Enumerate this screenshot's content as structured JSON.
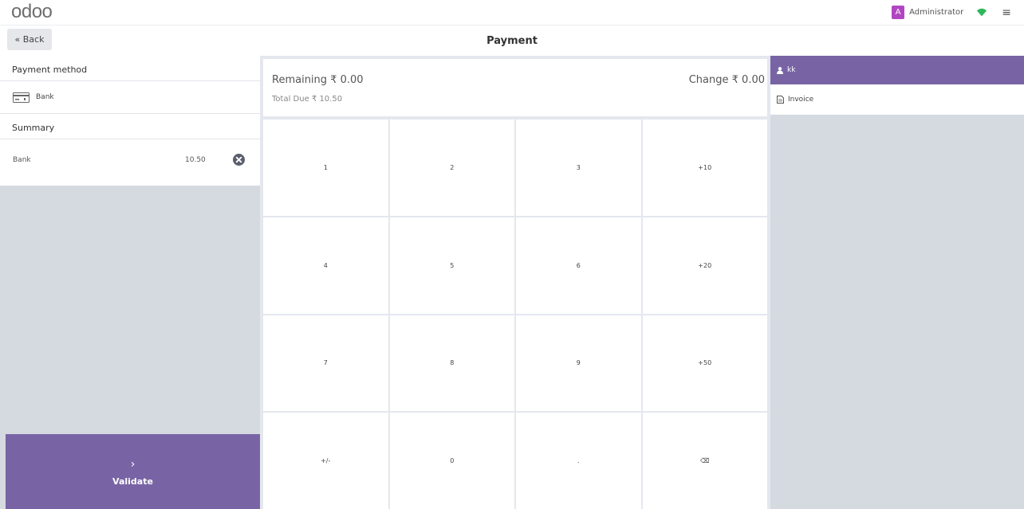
{
  "app": {
    "logo": "odoo"
  },
  "header": {
    "user_initial": "A",
    "user_name": "Administrator",
    "wifi_icon": "wifi-icon",
    "menu_icon": "hamburger-icon"
  },
  "subheader": {
    "back_label": "« Back",
    "title": "Payment"
  },
  "payment_methods": {
    "heading": "Payment method",
    "items": [
      {
        "label": "Bank",
        "icon": "bank-card-icon"
      }
    ]
  },
  "summary": {
    "heading": "Summary",
    "lines": [
      {
        "method": "Bank",
        "amount": "10.50"
      }
    ]
  },
  "validate": {
    "chevron": "›",
    "label": "Validate"
  },
  "totals": {
    "remaining": "Remaining ₹ 0.00",
    "change": "Change ₹ 0.00",
    "total_due": "Total Due ₹ 10.50"
  },
  "numpad": {
    "keys": [
      "1",
      "2",
      "3",
      "+10",
      "4",
      "5",
      "6",
      "+20",
      "7",
      "8",
      "9",
      "+50",
      "+/-",
      "0",
      ".",
      "⌫"
    ]
  },
  "customer": {
    "name": "kk"
  },
  "invoice": {
    "label": "Invoice"
  },
  "colors": {
    "accent": "#7864a5",
    "avatar": "#b146c2",
    "panel_bg": "#d5d9e0",
    "wifi": "#2eb85c"
  }
}
